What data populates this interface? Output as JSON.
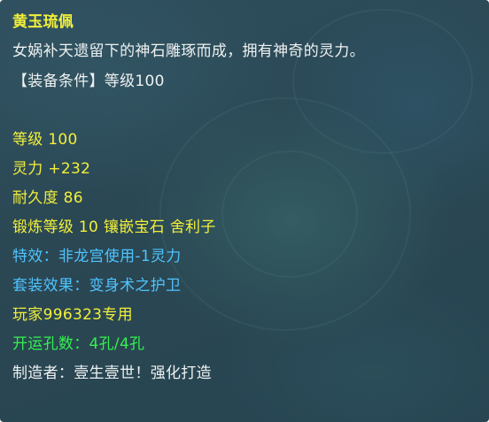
{
  "item": {
    "name": "黄玉琉佩",
    "description": "女娲补天遗留下的神石雕琢而成，拥有神奇的灵力。",
    "requirement": "【装备条件】等级100"
  },
  "stats": {
    "level": "等级 100",
    "spirit": "灵力 +232",
    "durability": "耐久度 86",
    "forge": "锻炼等级 10 镶嵌宝石 舍利子",
    "special_effect": "特效：非龙宫使用-1灵力",
    "set_effect": "套装效果：变身术之护卫",
    "owner": "玩家996323专用",
    "sockets": "开运孔数：4孔/4孔",
    "maker": "制造者：壹生壹世！强化打造"
  },
  "colors": {
    "yellow": "#f2ef3a",
    "white": "#eef1f1",
    "blue": "#4fc3ff",
    "green": "#34f04f"
  }
}
